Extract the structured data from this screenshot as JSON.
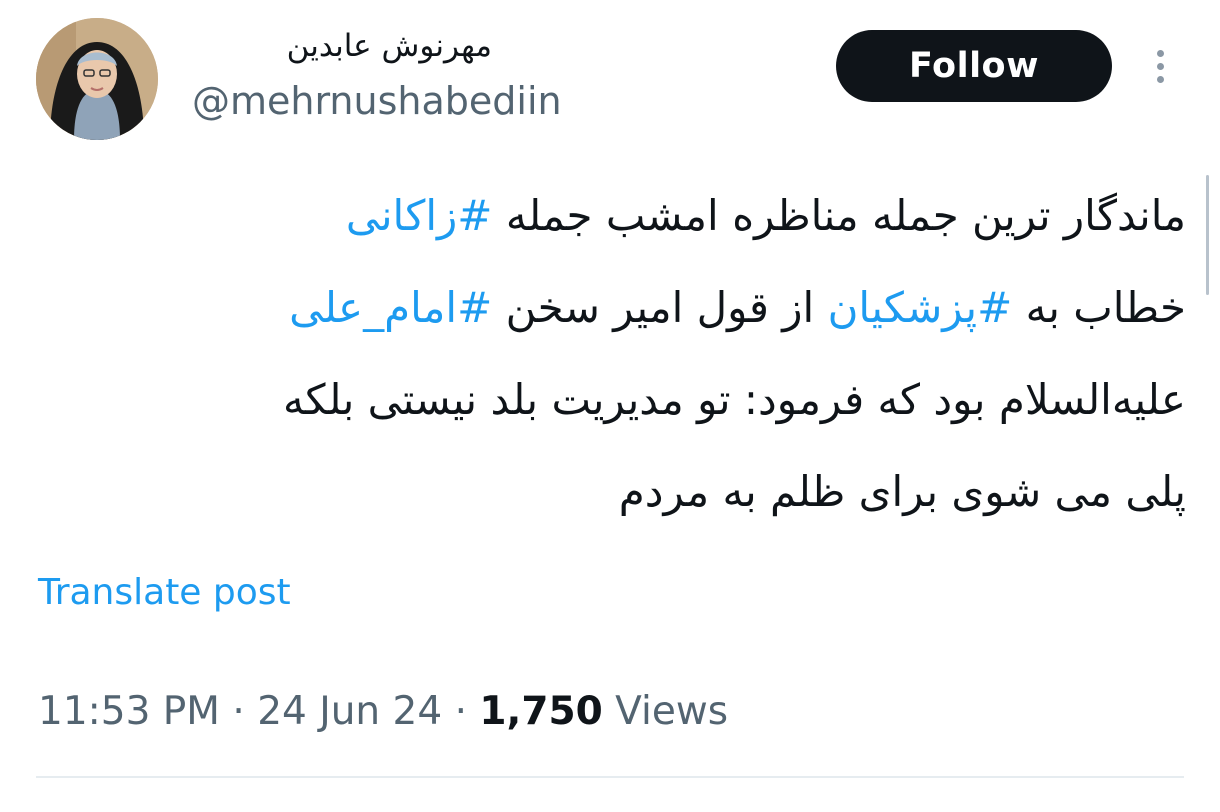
{
  "author": {
    "display_name": "مهرنوش عابدین",
    "handle": "@mehrnushabediin"
  },
  "actions": {
    "follow_label": "Follow",
    "more_icon": "vertical-ellipsis-icon"
  },
  "tweet": {
    "lines": [
      [
        {
          "text": "ماندگار ترین جمله مناظره امشب جمله ",
          "hashtag": false
        },
        {
          "text": "#زاکانی",
          "hashtag": true
        }
      ],
      [
        {
          "text": "خطاب به ",
          "hashtag": false
        },
        {
          "text": "#پزشکیان",
          "hashtag": true
        },
        {
          "text": " از قول امیر سخن ",
          "hashtag": false
        },
        {
          "text": "#امام_علی",
          "hashtag": true
        }
      ],
      [
        {
          "text": "علیه‌السلام بود که فرمود: تو مدیریت بلد نیستی بلکه",
          "hashtag": false
        }
      ],
      [
        {
          "text": "پلی می شوی برای ظلم به مردم",
          "hashtag": false
        }
      ]
    ],
    "translate_label": "Translate post"
  },
  "meta": {
    "time": "11:53 PM",
    "separator": "·",
    "date": "24 Jun 24",
    "views_count": "1,750",
    "views_label": "Views"
  },
  "colors": {
    "link": "#1d9bf0",
    "text": "#0f1419",
    "secondary": "#536471",
    "button_bg": "#0f1419"
  }
}
